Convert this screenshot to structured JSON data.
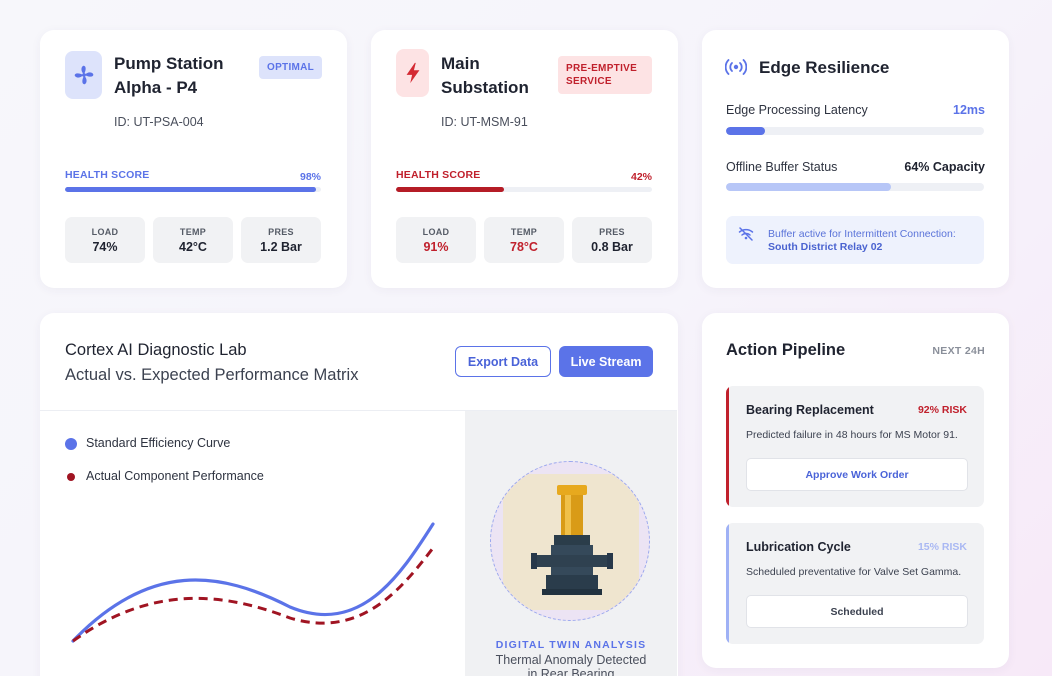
{
  "assets": [
    {
      "name_line1": "Pump Station",
      "name_line2": "Alpha - P4",
      "badge": "OPTIMAL",
      "id": "ID: UT-PSA-004",
      "icon": "fan-icon",
      "health_label": "HEALTH SCORE",
      "health_value": "98%",
      "health_fraction": 0.98,
      "metrics": [
        {
          "label": "LOAD",
          "value": "74%"
        },
        {
          "label": "TEMP",
          "value": "42°C"
        },
        {
          "label": "PRES",
          "value": "1.2 Bar"
        }
      ]
    },
    {
      "name_line1": "Main",
      "name_line2": "Substation",
      "badge_line1": "PRE-EMPTIVE",
      "badge_line2": "SERVICE",
      "id": "ID: UT-MSM-91",
      "icon": "lightning-icon",
      "health_label": "HEALTH SCORE",
      "health_value": "42%",
      "health_fraction": 0.42,
      "metrics": [
        {
          "label": "LOAD",
          "value": "91%"
        },
        {
          "label": "TEMP",
          "value": "78°C"
        },
        {
          "label": "PRES",
          "value": "0.8 Bar"
        }
      ]
    }
  ],
  "edge": {
    "title": "Edge Resilience",
    "icon": "broadcast-icon",
    "latency_label": "Edge Processing Latency",
    "latency_value": "12ms",
    "latency_fraction": 0.15,
    "buffer_label": "Offline Buffer Status",
    "buffer_value": "64% Capacity",
    "buffer_fraction": 0.64,
    "notice_line1": "Buffer active for Intermittent Connection:",
    "notice_line2": "South District Relay 02",
    "notice_icon": "wifi-off-icon"
  },
  "lab": {
    "title": "Cortex AI Diagnostic Lab",
    "subtitle": "Actual vs. Expected Performance Matrix",
    "export_label": "Export Data",
    "stream_label": "Live Stream",
    "legend": [
      {
        "name": "Standard Efficiency Curve",
        "color": "#5b73e8"
      },
      {
        "name": "Actual Component Performance",
        "color": "#a01422"
      }
    ],
    "twin_label": "DIGITAL TWIN ANALYSIS",
    "twin_desc_line1": "Thermal Anomaly Detected",
    "twin_desc_line2": "in Rear Bearing"
  },
  "pipeline": {
    "title": "Action Pipeline",
    "window": "NEXT 24H",
    "tasks": [
      {
        "title": "Bearing Replacement",
        "risk": "92% RISK",
        "desc": "Predicted failure in 48 hours for MS Motor 91.",
        "action": "Approve Work Order",
        "accent": "#c0202c"
      },
      {
        "title": "Lubrication Cycle",
        "risk": "15% RISK",
        "desc": "Scheduled preventative for Valve Set Gamma.",
        "action": "Scheduled",
        "accent": "#9fb1f5"
      }
    ]
  },
  "colors": {
    "accent": "#5b73e8",
    "danger": "#c0202c",
    "danger_bg": "#fde3e4"
  }
}
